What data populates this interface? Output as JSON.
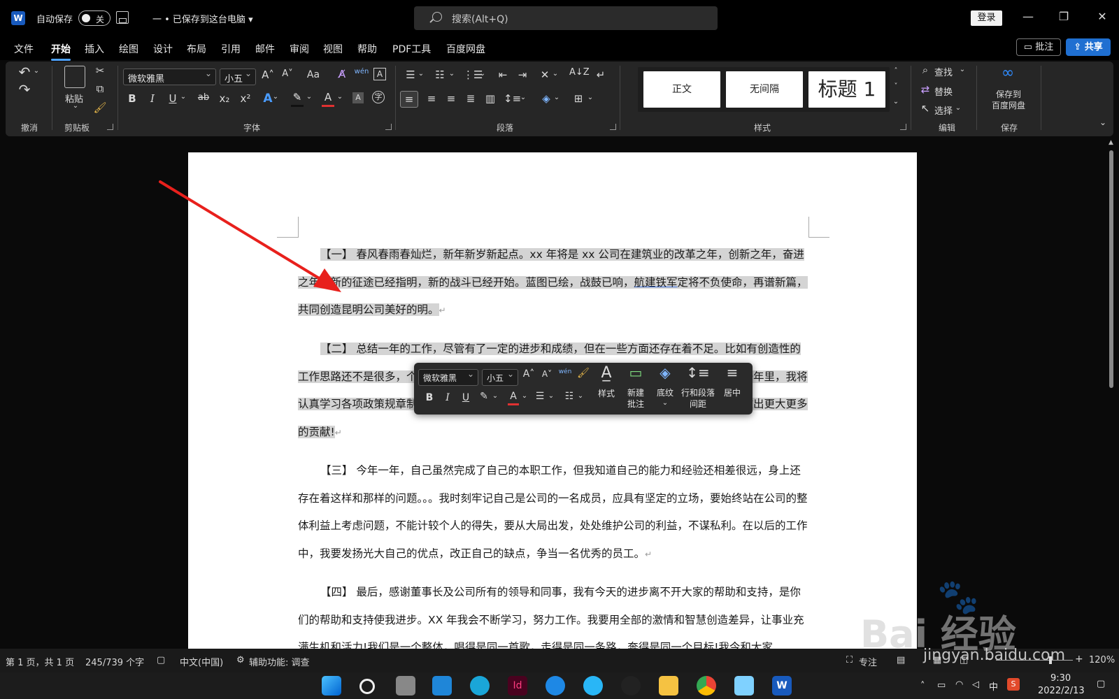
{
  "titlebar": {
    "app_logo": "W",
    "autosave_label": "自动保存",
    "autosave_state": "关",
    "doc_title": "一 • 已保存到这台电脑 ▾",
    "search_placeholder": "搜索(Alt+Q)",
    "login_label": "登录",
    "minimize": "—",
    "restore": "❐",
    "close": "✕"
  },
  "menu": {
    "items": [
      "文件",
      "开始",
      "插入",
      "绘图",
      "设计",
      "布局",
      "引用",
      "邮件",
      "审阅",
      "视图",
      "帮助",
      "PDF工具",
      "百度网盘"
    ],
    "active": "开始",
    "comment_button": "批注",
    "share_button": "共享"
  },
  "ribbon": {
    "groups": {
      "undo": "撤消",
      "clipboard": "剪贴板",
      "font": "字体",
      "paragraph": "段落",
      "styles": "样式",
      "editing": "编辑",
      "save": "保存"
    },
    "paste_label": "粘贴",
    "font_name": "微软雅黑",
    "font_size": "小五",
    "bold": "B",
    "italic": "I",
    "underline": "U",
    "strike": "ab",
    "subscript": "x₂",
    "superscript": "x²",
    "grow_font": "A˄",
    "shrink_font": "A˅",
    "change_case": "Aa",
    "phonetic": "wén",
    "styles_list": [
      "正文",
      "无间隔",
      "标题 1"
    ],
    "find": "查找",
    "replace": "替换",
    "select": "选择",
    "save_to_baidu": "保存到\n百度网盘",
    "save_to_baidu_line1": "保存到",
    "save_to_baidu_line2": "百度网盘"
  },
  "document": {
    "paragraphs": [
      {
        "highlight": true,
        "pre": "【一】 春风春雨春灿烂，新年新岁新起点。xx 年将是 xx 公司在建筑业的改革之年，创新之年，奋进之年。新的征途已经指明，新的战斗已经开始。蓝图已绘，战鼓已响，",
        "underlined": "航建铁军",
        "post": "定将不负使命，再谱新篇，共同创造昆明公司美好的明。"
      },
      {
        "highlight": true,
        "text": "【二】 总结一年的工作，尽管有了一定的进步和成绩，但在一些方面还存在着不足。比如有创造性的工作思路还不是很多，个别工作做得还不够完善，这有待于在今后的工作中加以改进。在新的一年里，我将认真学习各项政策规章制度，努力使思想觉悟和工作效率全面进入一个新水平，为公司的发展做出更大更多的贡献!"
      },
      {
        "highlight": false,
        "text": "【三】 今年一年，自己虽然完成了自己的本职工作，但我知道自己的能力和经验还相差很远，身上还存在着这样和那样的问题。。。我时刻牢记自己是公司的一名成员，应具有坚定的立场，要始终站在公司的整体利益上考虑问题，不能计较个人的得失，要从大局出发，处处维护公司的利益，不谋私利。在以后的工作中，我要发扬光大自己的优点，改正自己的缺点，争当一名优秀的员工。"
      },
      {
        "highlight": false,
        "text": "【四】 最后，感谢董事长及公司所有的领导和同事，我有今天的进步离不开大家的帮助和支持，是你们的帮助和支持使我进步。XX 年我会不断学习，努力工作。我要用全部的激情和智慧创造差异，让事业充满生机和活力!我们是一个整体，唱得是同一首歌，走得是同一条路，奔得是同一个目标!我今和大家"
      }
    ],
    "para_mark": "↵"
  },
  "minibar": {
    "font_name": "微软雅黑",
    "font_size": "小五",
    "styles": "样式",
    "new_comment_l1": "新建",
    "new_comment_l2": "批注",
    "shading": "底纹",
    "spacing_l1": "行和段落",
    "spacing_l2": "间距",
    "center": "居中",
    "bold": "B",
    "italic": "I",
    "underline": "U"
  },
  "statusbar": {
    "page": "第 1 页，共 1 页",
    "words": "245/739 个字",
    "language": "中文(中国)",
    "accessibility": "辅助功能: 调查",
    "focus": "专注",
    "zoom": "120%"
  },
  "taskbar": {
    "time": "9:30",
    "date": "2022/2/13",
    "ime": "中"
  },
  "watermark": {
    "text": "Bai 经验",
    "url": "jingyan.baidu.com"
  },
  "colors": {
    "accent": "#4fa3ff",
    "share": "#1f6fd1",
    "arrow": "#e8201c",
    "highlight": "#d4d4d4"
  }
}
